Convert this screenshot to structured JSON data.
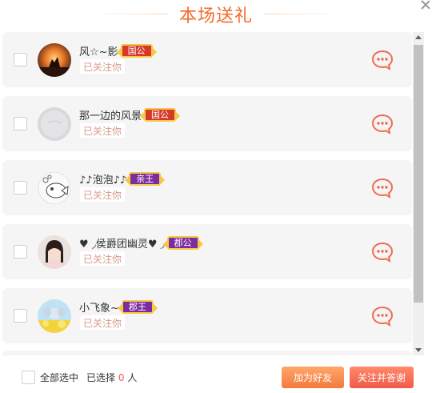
{
  "header": {
    "title": "本场送礼"
  },
  "rows": [
    {
      "name": "风☆~影",
      "badge": "国公",
      "badge_color": "red",
      "follow": "已关注你",
      "avatar": "sunset"
    },
    {
      "name": "那一边的风景",
      "badge": "国公",
      "badge_color": "red",
      "follow": "已关注你",
      "avatar": "gray"
    },
    {
      "name": "♪♪泡泡♪♪",
      "badge": "亲王",
      "badge_color": "purple",
      "follow": "已关注你",
      "avatar": "fish"
    },
    {
      "name": "♥ ◞侯爵团幽灵♥ ◞",
      "badge": "郡公",
      "badge_color": "purple",
      "follow": "已关注你",
      "avatar": "girl"
    },
    {
      "name": "小飞象~",
      "badge": "郡王",
      "badge_color": "purple",
      "follow": "已关注你",
      "avatar": "flower"
    }
  ],
  "footer": {
    "select_all": "全部选中",
    "selected_prefix": "已选择",
    "selected_count": "0",
    "selected_suffix": "人",
    "add_friend": "加为好友",
    "follow_thanks": "关注并答谢"
  },
  "colors": {
    "accent": "#f36b2a",
    "badge_red": "#d6382b",
    "badge_purple": "#7b2c9e",
    "chat_icon": "#f26a4d"
  }
}
